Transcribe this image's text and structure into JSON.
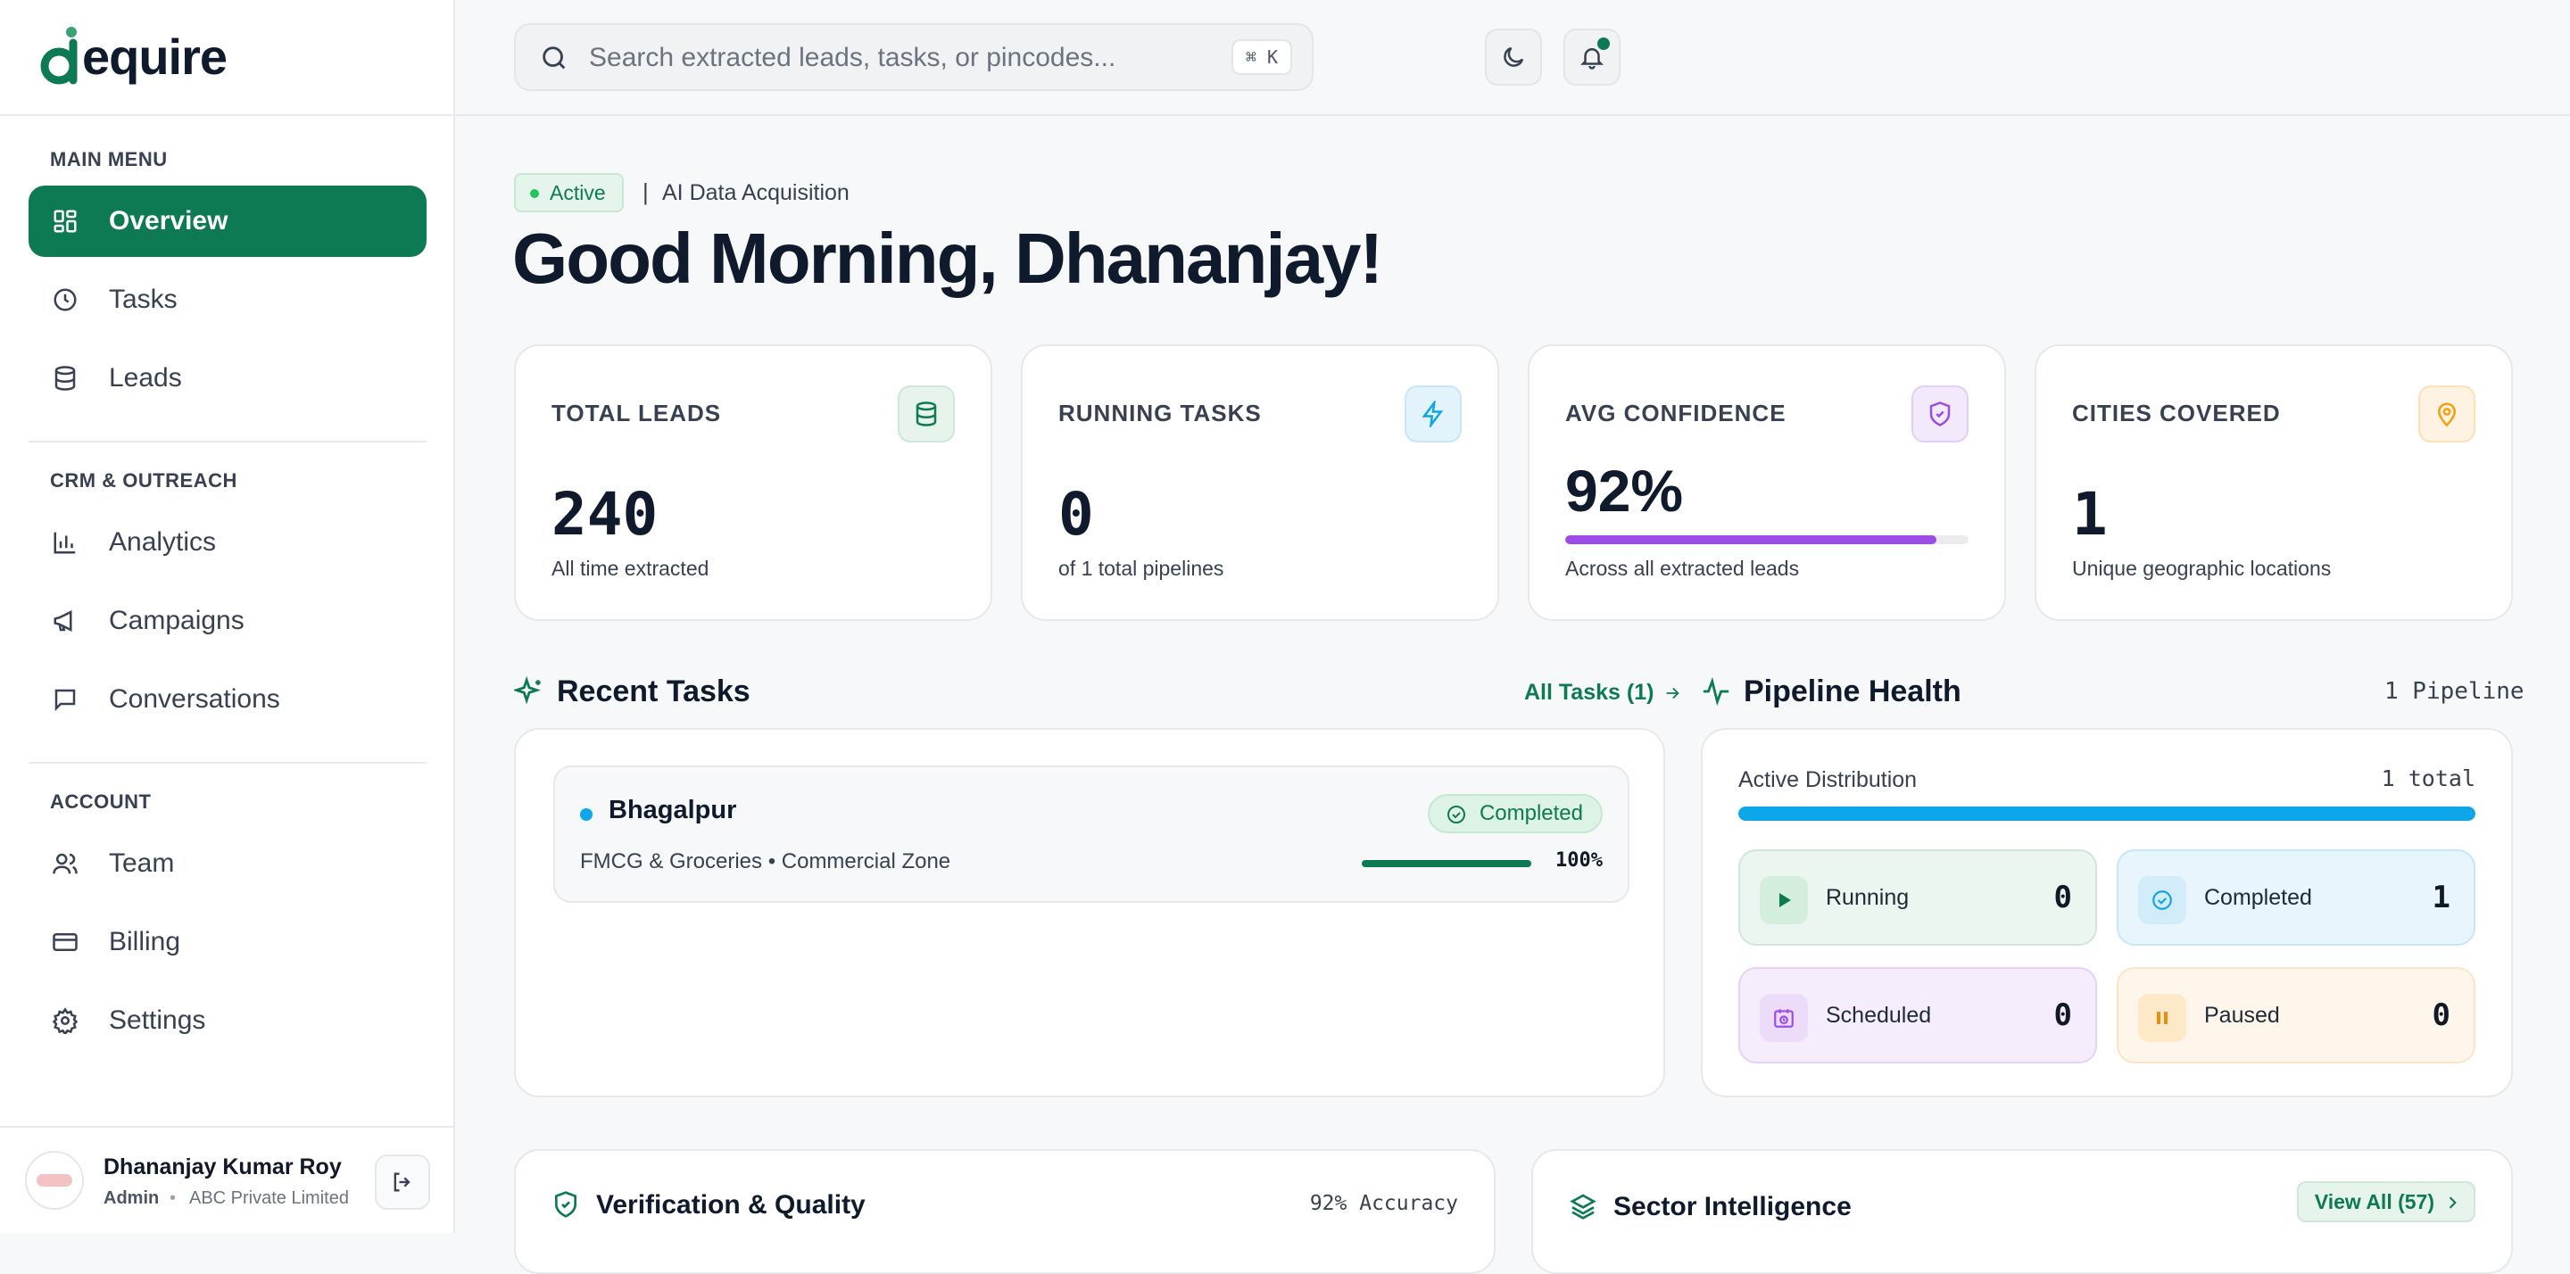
{
  "brand": {
    "name": "dequire",
    "accent": "#0e7a53"
  },
  "sidebar": {
    "sections": [
      {
        "label": "MAIN MENU"
      },
      {
        "label": "CRM & OUTREACH"
      },
      {
        "label": "ACCOUNT"
      }
    ],
    "items": [
      {
        "label": "Overview",
        "icon": "dashboard-icon",
        "active": true
      },
      {
        "label": "Tasks",
        "icon": "clock-icon"
      },
      {
        "label": "Leads",
        "icon": "database-icon"
      },
      {
        "label": "Analytics",
        "icon": "bar-chart-icon"
      },
      {
        "label": "Campaigns",
        "icon": "megaphone-icon"
      },
      {
        "label": "Conversations",
        "icon": "chat-icon"
      },
      {
        "label": "Team",
        "icon": "users-icon"
      },
      {
        "label": "Billing",
        "icon": "credit-card-icon"
      },
      {
        "label": "Settings",
        "icon": "gear-icon"
      }
    ],
    "user": {
      "name": "Dhananjay Kumar Roy",
      "role": "Admin",
      "separator": "•",
      "company": "ABC Private Limited"
    }
  },
  "topbar": {
    "search_placeholder": "Search extracted leads, tasks, or pincodes...",
    "shortcut": "⌘ K"
  },
  "header": {
    "status": "Active",
    "separator": "|",
    "subtitle": "AI Data Acquisition",
    "greeting": "Good Morning, Dhananjay!"
  },
  "stats": [
    {
      "label": "TOTAL LEADS",
      "value": "240",
      "desc": "All time extracted",
      "icon": "database-icon",
      "color": "#0e7a53"
    },
    {
      "label": "RUNNING TASKS",
      "value": "0",
      "desc": "of 1 total pipelines",
      "icon": "lightning-icon",
      "color": "#0ea5e9"
    },
    {
      "label": "AVG CONFIDENCE",
      "value": "92%",
      "desc": "Across all extracted leads",
      "icon": "shield-icon",
      "color": "#9b4de6",
      "progress": 0.92
    },
    {
      "label": "CITIES COVERED",
      "value": "1",
      "desc": "Unique geographic locations",
      "icon": "map-pin-icon",
      "color": "#f59e0b"
    }
  ],
  "recent_tasks": {
    "title": "Recent Tasks",
    "link": "All Tasks (1)",
    "items": [
      {
        "city": "Bhagalpur",
        "meta": "FMCG & Groceries • Commercial Zone",
        "status": "Completed",
        "progress_label": "100%",
        "progress": 1.0
      }
    ]
  },
  "pipeline": {
    "title": "Pipeline Health",
    "count_label": "1 Pipeline",
    "dist_label": "Active Distribution",
    "total_label": "1 total",
    "tiles": [
      {
        "label": "Running",
        "value": "0",
        "icon": "play-icon"
      },
      {
        "label": "Completed",
        "value": "1",
        "icon": "check-circle-icon"
      },
      {
        "label": "Scheduled",
        "value": "0",
        "icon": "calendar-clock-icon"
      },
      {
        "label": "Paused",
        "value": "0",
        "icon": "pause-icon"
      }
    ]
  },
  "verification": {
    "title": "Verification & Quality",
    "accuracy": "92% Accuracy"
  },
  "sector": {
    "title": "Sector Intelligence",
    "link": "View All (57)"
  }
}
